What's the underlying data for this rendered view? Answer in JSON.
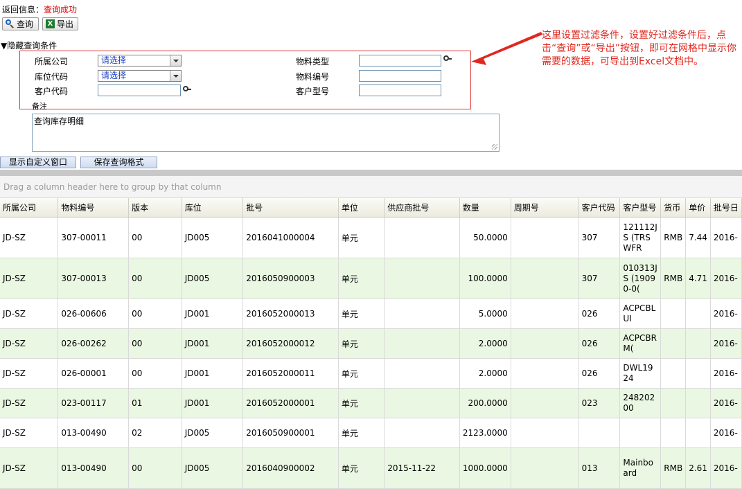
{
  "status": {
    "label": "返回信息：",
    "value": "查询成功"
  },
  "toolbar": {
    "query_label": "查询",
    "export_label": "导出"
  },
  "filter": {
    "toggle_label": "▼隐藏查询条件",
    "company_label": "所属公司",
    "company_value": "请选择",
    "warehouse_label": "库位代码",
    "warehouse_value": "请选择",
    "customer_code_label": "客户代码",
    "material_type_label": "物料类型",
    "material_no_label": "物料编号",
    "customer_model_label": "客户型号",
    "remark_label": "备注",
    "remark_value": "查询库存明细"
  },
  "buttons": {
    "show_custom": "显示自定义窗口",
    "save_format": "保存查询格式"
  },
  "grid": {
    "group_hint": "Drag a column header here to group by that column",
    "columns": [
      "所属公司",
      "物料编号",
      "版本",
      "库位",
      "批号",
      "单位",
      "供应商批号",
      "数量",
      "周期号",
      "客户代码",
      "客户型号",
      "货币",
      "单价",
      "批号日"
    ],
    "rows": [
      [
        "JD-SZ",
        "307-00011",
        "00",
        "JD005",
        "2016041000004",
        "单元",
        "",
        "50.0000",
        "",
        "307",
        "121112JS (TRSWFR",
        "RMB",
        "7.44",
        "2016-"
      ],
      [
        "JD-SZ",
        "307-00013",
        "00",
        "JD005",
        "2016050900003",
        "单元",
        "",
        "100.0000",
        "",
        "307",
        "010313JS (19090-0(",
        "RMB",
        "4.71",
        "2016-"
      ],
      [
        "JD-SZ",
        "026-00606",
        "00",
        "JD001",
        "2016052000013",
        "单元",
        "",
        "5.0000",
        "",
        "026",
        "ACPCBLUI",
        "",
        "",
        "2016-"
      ],
      [
        "JD-SZ",
        "026-00262",
        "00",
        "JD001",
        "2016052000012",
        "单元",
        "",
        "2.0000",
        "",
        "026",
        "ACPCBRM(",
        "",
        "",
        "2016-"
      ],
      [
        "JD-SZ",
        "026-00001",
        "00",
        "JD001",
        "2016052000011",
        "单元",
        "",
        "2.0000",
        "",
        "026",
        "DWL1924",
        "",
        "",
        "2016-"
      ],
      [
        "JD-SZ",
        "023-00117",
        "01",
        "JD001",
        "2016052000001",
        "单元",
        "",
        "200.0000",
        "",
        "023",
        "24820200",
        "",
        "",
        "2016-"
      ],
      [
        "JD-SZ",
        "013-00490",
        "02",
        "JD005",
        "2016050900001",
        "单元",
        "",
        "2123.0000",
        "",
        "",
        "",
        "",
        "",
        "2016-"
      ],
      [
        "JD-SZ",
        "013-00490",
        "00",
        "JD005",
        "2016040900002",
        "单元",
        "2015-11-22",
        "1000.0000",
        "",
        "013",
        "Mainboard",
        "RMB",
        "2.61",
        "2016-"
      ]
    ]
  },
  "annotation": "这里设置过滤条件，设置好过滤条件后，点击“查询”或“导出”按钮，即可在网格中显示你需要的数据，可导出到Excel文档中。",
  "colors": {
    "status_ok": "#e00000",
    "annotation": "#e0281f",
    "alt_row": "#eaf7e2",
    "filter_border": "#e03535"
  }
}
